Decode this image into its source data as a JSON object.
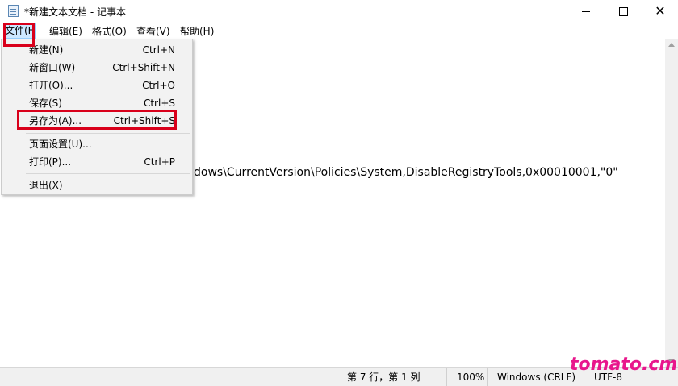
{
  "window": {
    "title": "*新建文本文档 - 记事本",
    "min_icon": "minimize-icon",
    "max_icon": "maximize-icon",
    "close_icon": "close-icon",
    "close_glyph": "✕"
  },
  "menubar": {
    "file": "文件(F",
    "edit": "编辑(E)",
    "format": "格式(O)",
    "view": "查看(V)",
    "help": "帮助(H)"
  },
  "file_menu": {
    "items": [
      {
        "label": "新建(N)",
        "shortcut": "Ctrl+N"
      },
      {
        "label": "新窗口(W)",
        "shortcut": "Ctrl+Shift+N"
      },
      {
        "label": "打开(O)...",
        "shortcut": "Ctrl+O"
      },
      {
        "label": "保存(S)",
        "shortcut": "Ctrl+S"
      },
      {
        "label": "另存为(A)...",
        "shortcut": "Ctrl+Shift+S"
      },
      {
        "label": "页面设置(U)...",
        "shortcut": ""
      },
      {
        "label": "打印(P)...",
        "shortcut": "Ctrl+P"
      },
      {
        "label": "退出(X)",
        "shortcut": ""
      }
    ]
  },
  "editor": {
    "visible_text": "dows\\CurrentVersion\\Policies\\System,DisableRegistryTools,0x00010001,\"0\""
  },
  "statusbar": {
    "position": "第 7 行，第 1 列",
    "zoom": "100%",
    "line_ending": "Windows (CRLF)",
    "encoding": "UTF-8"
  },
  "watermark": "tomato.cm",
  "colors": {
    "highlight_red": "#d9001b",
    "menu_active_bg": "#cce8ff",
    "watermark": "#e8178c"
  }
}
